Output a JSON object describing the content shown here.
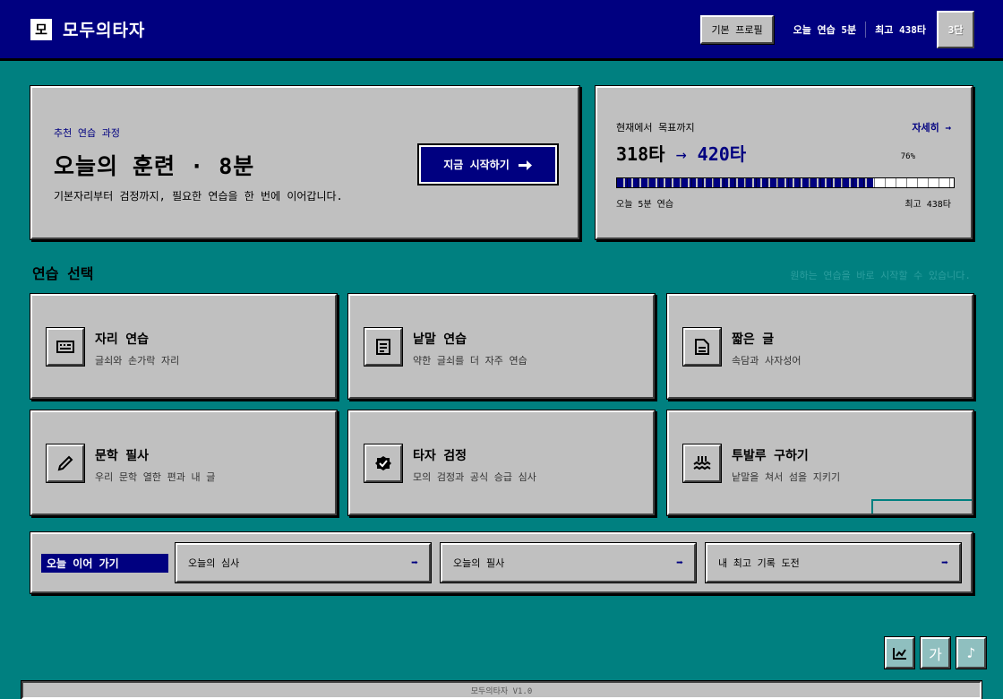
{
  "header": {
    "logo": "모",
    "brand": "모두의타자",
    "profile_label": "기본 프로필",
    "today_practice": "오늘 연습 5분",
    "best_record": "최고 438타",
    "level": "3단"
  },
  "hero": {
    "kicker": "추천 연습 과정",
    "title": "오늘의 훈련 · 8분",
    "description": "기본자리부터 검정까지, 필요한 연습을 한 번에 이어갑니다.",
    "start_label": "지금 시작하기"
  },
  "goal": {
    "label": "현재에서 목표까지",
    "detail_label": "자세히 →",
    "current": "318타",
    "arrow": "→",
    "target": "420타",
    "percent_label": "76%",
    "percent": 0.76,
    "footer_left": "오늘 5분 연습",
    "footer_right": "최고 438타"
  },
  "section": {
    "title": "연습 선택",
    "hint": "원하는 연습을 바로 시작할 수 있습니다."
  },
  "cards": [
    {
      "icon": "keyboard-icon",
      "title": "자리 연습",
      "subtitle": "글쇠와 손가락 자리"
    },
    {
      "icon": "document-lines-icon",
      "title": "낱말 연습",
      "subtitle": "약한 글쇠를 더 자주 연습"
    },
    {
      "icon": "file-icon",
      "title": "짧은 글",
      "subtitle": "속담과 사자성어"
    },
    {
      "icon": "pencil-icon",
      "title": "문학 필사",
      "subtitle": "우리 문학 열한 편과 내 글"
    },
    {
      "icon": "badge-check-icon",
      "title": "타자 검정",
      "subtitle": "모의 검정과 공식 승급 심사"
    },
    {
      "icon": "waves-icon",
      "title": "투발루 구하기",
      "subtitle": "낱말을 쳐서 섬을 지키기"
    }
  ],
  "continue": {
    "label": "오늘 이어 가기",
    "items": [
      {
        "label": "오늘의 심사",
        "arrow": "➡"
      },
      {
        "label": "오늘의 필사",
        "arrow": "➡"
      },
      {
        "label": "내 최고 기록 도전",
        "arrow": "➡"
      }
    ]
  },
  "tools": {
    "chart": "chart-icon",
    "font_label": "가",
    "music_label": "♪"
  },
  "status": {
    "version": "모두의타자 V1.0"
  }
}
